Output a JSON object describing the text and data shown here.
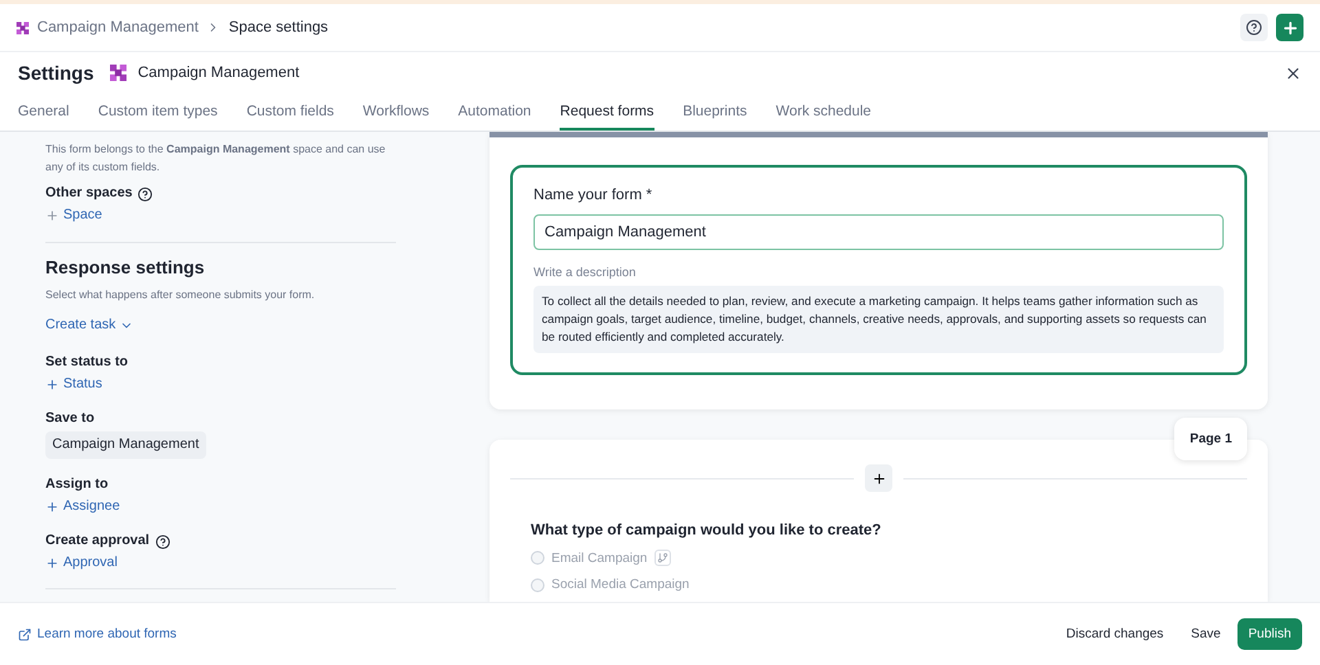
{
  "breadcrumb": {
    "items": [
      "Campaign Management",
      "Space settings"
    ]
  },
  "header": {
    "title": "Settings",
    "space": "Campaign Management"
  },
  "tabs": [
    {
      "label": "General",
      "selected": false
    },
    {
      "label": "Custom item types",
      "selected": false
    },
    {
      "label": "Custom fields",
      "selected": false
    },
    {
      "label": "Workflows",
      "selected": false
    },
    {
      "label": "Automation",
      "selected": false
    },
    {
      "label": "Request forms",
      "selected": true
    },
    {
      "label": "Blueprints",
      "selected": false
    },
    {
      "label": "Work schedule",
      "selected": false
    }
  ],
  "sidebar": {
    "intro": "This form belongs to the **Campaign Management** space and can use any of its custom fields.",
    "other_spaces": {
      "label": "Other spaces",
      "action": "Space"
    },
    "response_title": "Response settings",
    "response_hint": "Select what happens after someone submits your form.",
    "mode": "Create task",
    "sections": [
      {
        "kind": "add",
        "label": "Set status to",
        "action": "Status",
        "help": false
      },
      {
        "kind": "chip",
        "label": "Save to",
        "value": "Campaign Management",
        "help": false
      },
      {
        "kind": "add",
        "label": "Assign to",
        "action": "Assignee",
        "help": false
      },
      {
        "kind": "add",
        "label": "Create approval",
        "action": "Approval",
        "help": true
      }
    ]
  },
  "form": {
    "name_label": "Name your form *",
    "name_value": "Campaign Management",
    "description_label": "Write a description",
    "description": "To collect all the details needed to plan, review, and execute a marketing campaign. It helps teams gather information such as campaign goals, target audience, timeline, budget, channels, creative needs, approvals, and supporting assets so requests can be routed efficiently and completed accurately.",
    "page_label": "Page 1",
    "question": "What type of campaign would you like to create?",
    "options": [
      {
        "label": "Email Campaign",
        "selected": false,
        "logic": true
      },
      {
        "label": "Social Media Campaign",
        "selected": false,
        "logic": false
      }
    ]
  },
  "footer": {
    "link": "Learn more about forms",
    "buttons": [
      {
        "kind": "plain",
        "label": "Discard changes"
      },
      {
        "kind": "plain",
        "label": "Save"
      },
      {
        "kind": "primary",
        "label": "Publish"
      }
    ]
  }
}
